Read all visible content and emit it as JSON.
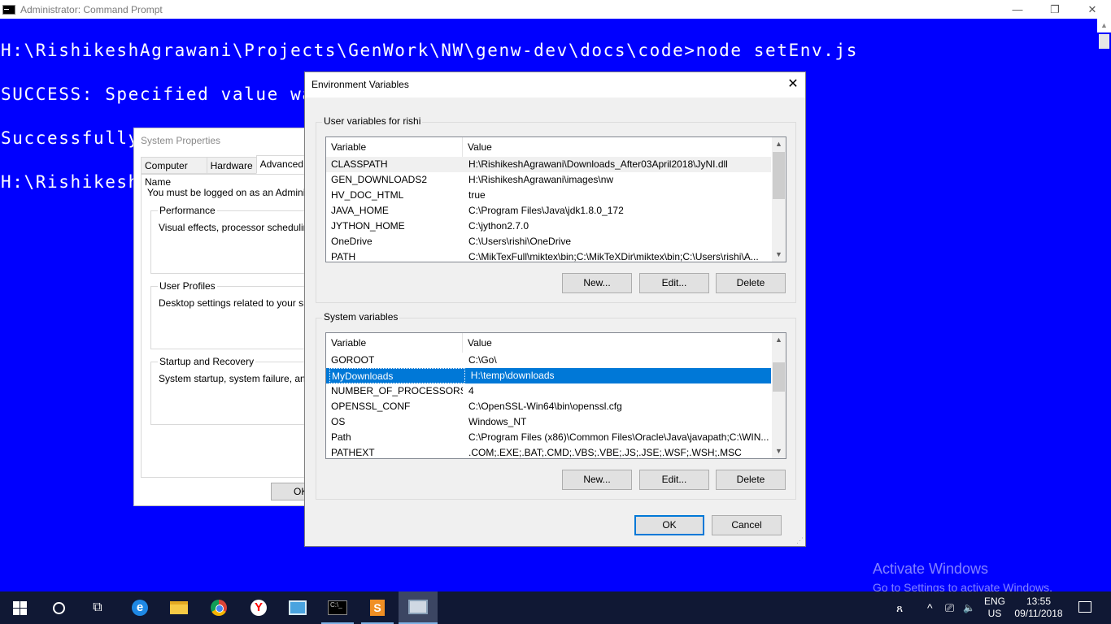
{
  "cmd": {
    "title": "Administrator: Command Prompt",
    "lines": [
      "H:\\RishikeshAgrawani\\Projects\\GenWork\\NW\\genw-dev\\docs\\code>node setEnv.js",
      "SUCCESS: Specified value wa",
      "Successfully",
      "H:\\Rishikesh"
    ],
    "controls": {
      "minimize": "—",
      "restore": "❐",
      "close": "✕"
    }
  },
  "sysprops": {
    "title": "System Properties",
    "tabs": [
      "Computer Name",
      "Hardware",
      "Advanced"
    ],
    "intro": "You must be logged on as an Administra",
    "groups": [
      {
        "label": "Performance",
        "text": "Visual effects, processor scheduling, m"
      },
      {
        "label": "User Profiles",
        "text": "Desktop settings related to your sign-in"
      },
      {
        "label": "Startup and Recovery",
        "text": "System startup, system failure, and deb"
      }
    ],
    "ok_label": "OK"
  },
  "env": {
    "title": "Environment Variables",
    "close": "✕",
    "user_section_label": "User variables for rishi",
    "system_section_label": "System variables",
    "col_variable": "Variable",
    "col_value": "Value",
    "user_vars": [
      {
        "name": "CLASSPATH",
        "value": "H:\\RishikeshAgrawani\\Downloads_After03April2018\\JyNI.dll"
      },
      {
        "name": "GEN_DOWNLOADS2",
        "value": "H:\\RishikeshAgrawani\\images\\nw"
      },
      {
        "name": "HV_DOC_HTML",
        "value": "true"
      },
      {
        "name": "JAVA_HOME",
        "value": "C:\\Program Files\\Java\\jdk1.8.0_172"
      },
      {
        "name": "JYTHON_HOME",
        "value": "C:\\jython2.7.0"
      },
      {
        "name": "OneDrive",
        "value": "C:\\Users\\rishi\\OneDrive"
      },
      {
        "name": "PATH",
        "value": "C:\\MikTexFull\\miktex\\bin;C:\\MikTeXDir\\miktex\\bin;C:\\Users\\rishi\\A..."
      }
    ],
    "system_vars": [
      {
        "name": "GOROOT",
        "value": "C:\\Go\\"
      },
      {
        "name": "MyDownloads",
        "value": "H:\\temp\\downloads"
      },
      {
        "name": "NUMBER_OF_PROCESSORS",
        "value": "4"
      },
      {
        "name": "OPENSSL_CONF",
        "value": "C:\\OpenSSL-Win64\\bin\\openssl.cfg"
      },
      {
        "name": "OS",
        "value": "Windows_NT"
      },
      {
        "name": "Path",
        "value": "C:\\Program Files (x86)\\Common Files\\Oracle\\Java\\javapath;C:\\WIN..."
      },
      {
        "name": "PATHEXT",
        "value": ".COM;.EXE;.BAT;.CMD;.VBS;.VBE;.JS;.JSE;.WSF;.WSH;.MSC"
      }
    ],
    "buttons": {
      "new": "New...",
      "edit": "Edit...",
      "delete": "Delete",
      "ok": "OK",
      "cancel": "Cancel"
    }
  },
  "watermark": {
    "line1": "Activate Windows",
    "line2": "Go to Settings to activate Windows."
  },
  "taskbar": {
    "items": [
      "start-icon",
      "cortana-icon",
      "task-view-icon",
      "edge-icon",
      "file-explorer-icon",
      "chrome-icon",
      "yandex-icon",
      "system-info-icon",
      "command-prompt-icon",
      "sublime-text-icon",
      "system-properties-icon"
    ],
    "edge_glyph": "e",
    "yandex_glyph": "Y",
    "sublime_glyph": "S",
    "cmd_glyph": "C:\\_",
    "tray": {
      "people_glyph": "ጸ",
      "chevron": "^",
      "network_glyph": "⎚",
      "volume_glyph": "🔈",
      "lang": "ENG",
      "region": "US",
      "time": "13:55",
      "date": "09/11/2018"
    }
  },
  "colors": {
    "desktop": "#0000ff",
    "selection": "#0078d7",
    "taskbar": "#101834"
  }
}
